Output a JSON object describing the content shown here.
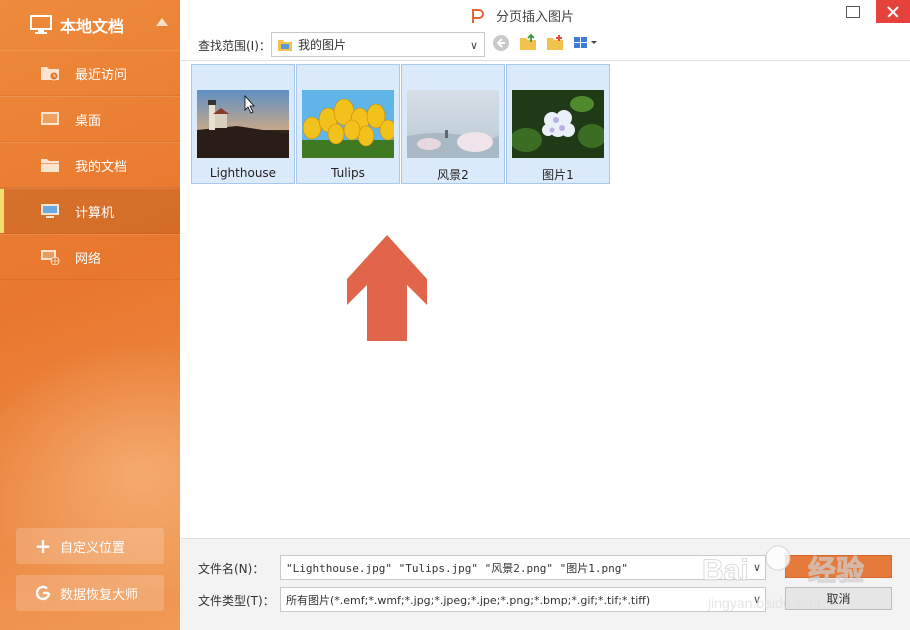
{
  "sidebar": {
    "title": "本地文档",
    "items": [
      {
        "label": "最近访问",
        "icon": "recent-folder-icon",
        "active": false
      },
      {
        "label": "桌面",
        "icon": "desktop-icon",
        "active": false
      },
      {
        "label": "我的文档",
        "icon": "folder-icon",
        "active": false
      },
      {
        "label": "计算机",
        "icon": "computer-icon",
        "active": true
      },
      {
        "label": "网络",
        "icon": "network-icon",
        "active": false
      }
    ],
    "custom_location_label": "自定义位置",
    "data_recovery_label": "数据恢复大师"
  },
  "dialog": {
    "title": "分页插入图片",
    "look_in_label": "查找范围(I)：",
    "look_in_value": "我的图片"
  },
  "files": [
    {
      "name": "Lighthouse"
    },
    {
      "name": "Tulips"
    },
    {
      "name": "风景2"
    },
    {
      "name": "图片1"
    }
  ],
  "footer": {
    "filename_label": "文件名(N)：",
    "filename_value": "\"Lighthouse.jpg\" \"Tulips.jpg\" \"风景2.png\" \"图片1.png\"",
    "filetype_label": "文件类型(T)：",
    "filetype_value": "所有图片(*.emf;*.wmf;*.jpg;*.jpeg;*.jpe;*.png;*.bmp;*.gif;*.tif;*.tiff)",
    "cancel_label": "取消"
  },
  "colors": {
    "sidebar": "#e8772d",
    "accent_arrow": "#e0654a",
    "selection": "#dbeafb",
    "close_button": "#e5413d"
  },
  "watermark": {
    "text": "Baidu 经验",
    "subtext": "jingyan.baidu.com"
  }
}
